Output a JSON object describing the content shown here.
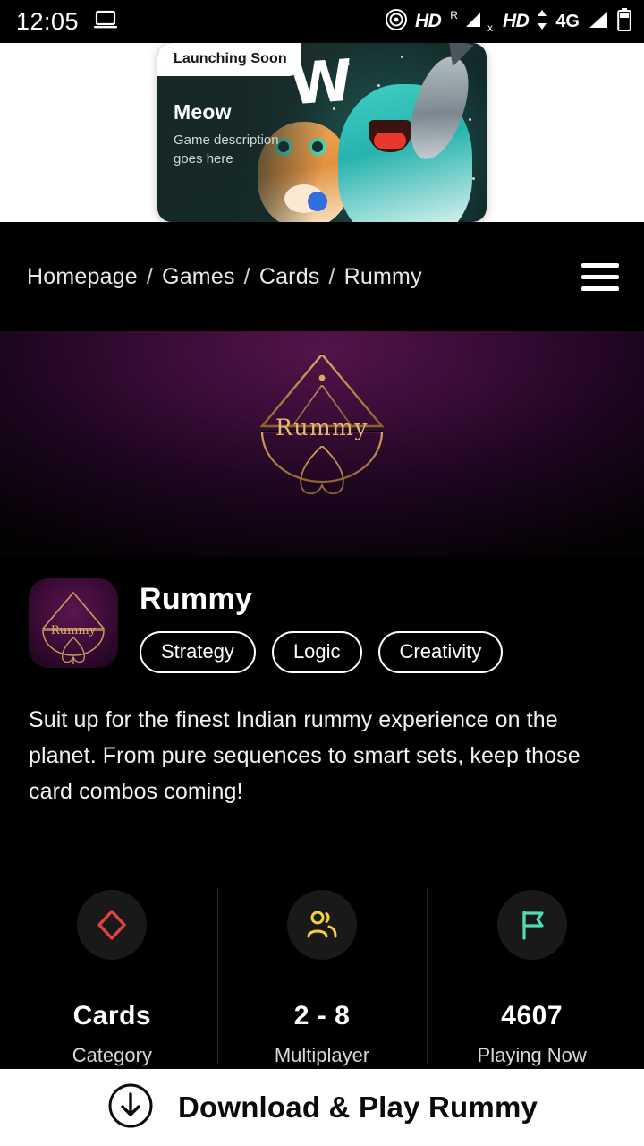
{
  "status_bar": {
    "time": "12:05",
    "left_icons": [
      "laptop-icon"
    ],
    "right_icons": [
      "nfc-icon",
      "hd-icon",
      "roaming-r",
      "signal-off-icon",
      "hd-icon",
      "data-arrows-icon",
      "signal-icon",
      "battery-icon"
    ],
    "hd_label_1": "HD",
    "roaming_label": "R",
    "roaming_x": "x",
    "hd_label_2": "HD",
    "network_label": "4G"
  },
  "promo_banner": {
    "badge": "Launching Soon",
    "title": "Meow",
    "description": "Game description goes here",
    "watermark": "W"
  },
  "breadcrumb": {
    "items": [
      "Homepage",
      "Games",
      "Cards",
      "Rummy"
    ],
    "separator": "/",
    "menu_icon": "hamburger-icon"
  },
  "hero": {
    "logo_text": "Rummy",
    "logo_alt": "rummy-spade-logo"
  },
  "app": {
    "icon_text": "Rummy",
    "title": "Rummy",
    "tags": [
      "Strategy",
      "Logic",
      "Creativity"
    ],
    "description": "Suit up for the finest Indian rummy experience on the planet. From pure sequences to smart sets, keep those card combos coming!"
  },
  "stats": [
    {
      "icon": "diamond-suit-icon",
      "icon_color": "#e0443f",
      "value": "Cards",
      "label": "Category"
    },
    {
      "icon": "users-icon",
      "icon_color": "#f5cf3d",
      "value": "2 - 8",
      "label": "Multiplayer"
    },
    {
      "icon": "flag-icon",
      "icon_color": "#4fdcb4",
      "value": "4607",
      "label": "Playing Now"
    }
  ],
  "cta": {
    "icon": "download-circle-icon",
    "label": "Download & Play Rummy"
  },
  "colors": {
    "background": "#000000",
    "hero_purple": "#53144a",
    "cta_background": "#ffffff",
    "accent_gold": "#c08b3e"
  }
}
